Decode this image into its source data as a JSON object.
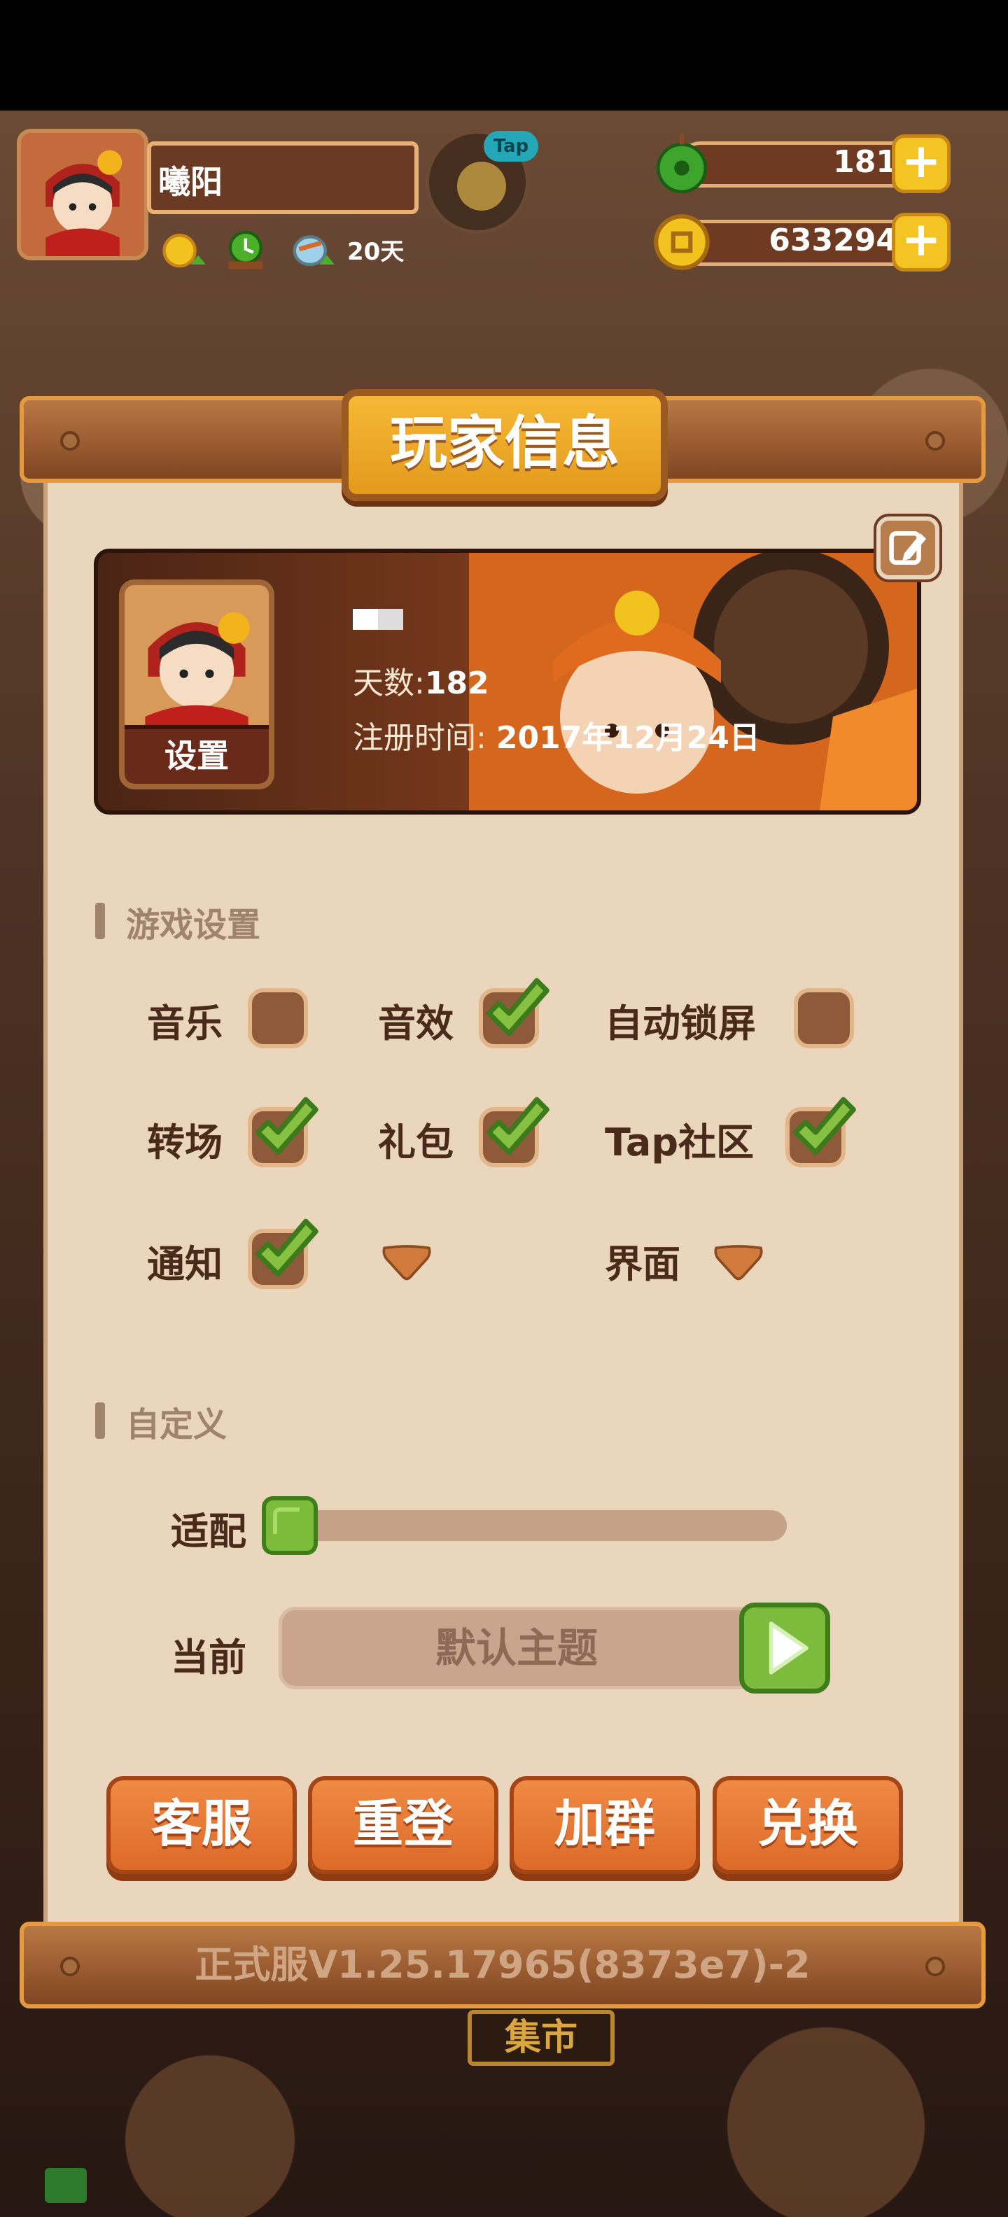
{
  "hud": {
    "player_name": "曦阳",
    "buff_days": "20天",
    "tap_badge": "Tap",
    "jade_amount": "181",
    "coin_amount": "633294",
    "plus": "+"
  },
  "panel": {
    "title": "玩家信息",
    "profile": {
      "set_label": "设置",
      "days_label": "天数:",
      "days_value": "182",
      "reg_label": "注册时间:",
      "reg_value": "2017年12月24日"
    },
    "game_settings": {
      "title": "游戏设置",
      "options": [
        {
          "label": "音乐",
          "checked": false
        },
        {
          "label": "音效",
          "checked": true
        },
        {
          "label": "自动锁屏",
          "checked": false
        },
        {
          "label": "转场",
          "checked": true
        },
        {
          "label": "礼包",
          "checked": true
        },
        {
          "label": "Tap社区",
          "checked": true
        },
        {
          "label": "通知",
          "checked": true
        },
        {
          "label": "",
          "dropdown": true
        },
        {
          "label": "界面",
          "dropdown": true
        }
      ]
    },
    "custom": {
      "title": "自定义",
      "fit_label": "适配",
      "fit_value": 0,
      "current_label": "当前",
      "theme_value": "默认主题"
    },
    "buttons": [
      "客服",
      "重登",
      "加群",
      "兑换"
    ],
    "version": "正式服V1.25.17965(8373e7)-2"
  },
  "background": {
    "market_sign": "集市"
  },
  "colors": {
    "accent_orange": "#dd6a2a",
    "panel_bg": "#e9d6bd",
    "check_green": "#7cbb3c",
    "gold": "#f4c324"
  }
}
